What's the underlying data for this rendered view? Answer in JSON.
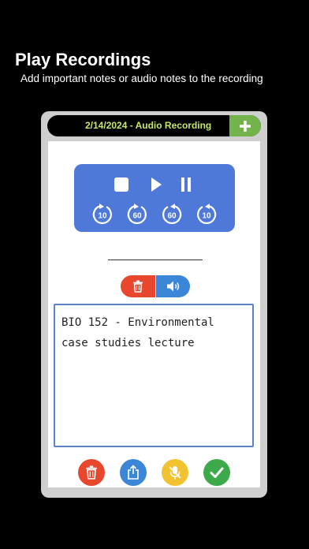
{
  "screen": {
    "headline": "Play Recordings",
    "subline": "Add important notes or audio notes to the recording"
  },
  "recording": {
    "title": "2/14/2024 - Audio Recording",
    "add_icon": "plus-icon"
  },
  "player": {
    "buttons": [
      {
        "name": "stop",
        "icon": "stop-icon"
      },
      {
        "name": "play",
        "icon": "play-icon"
      },
      {
        "name": "pause",
        "icon": "pause-icon"
      }
    ],
    "skip_buttons": [
      {
        "name": "rewind-10",
        "label": "10",
        "direction": "back"
      },
      {
        "name": "rewind-60",
        "label": "60",
        "direction": "back"
      },
      {
        "name": "forward-60",
        "label": "60",
        "direction": "forward"
      },
      {
        "name": "forward-10",
        "label": "10",
        "direction": "forward"
      }
    ]
  },
  "note_toolbar": {
    "delete_icon": "trash-icon",
    "audio_icon": "speaker-icon"
  },
  "note": {
    "text": "BIO 152 - Environmental case studies lecture"
  },
  "bottom_actions": [
    {
      "name": "delete",
      "icon": "trash-icon",
      "color": "#e8472e"
    },
    {
      "name": "share",
      "icon": "share-icon",
      "color": "#3b86d6"
    },
    {
      "name": "mic-off",
      "icon": "mic-off-icon",
      "color": "#f2c230"
    },
    {
      "name": "confirm",
      "icon": "check-icon",
      "color": "#3ca94a"
    }
  ],
  "colors": {
    "background": "#000000",
    "card": "#cfcfcf",
    "title_text": "#c7e86a",
    "add_button": "#74b34b",
    "player": "#4f79d9",
    "notes_border": "#5b82c9"
  }
}
